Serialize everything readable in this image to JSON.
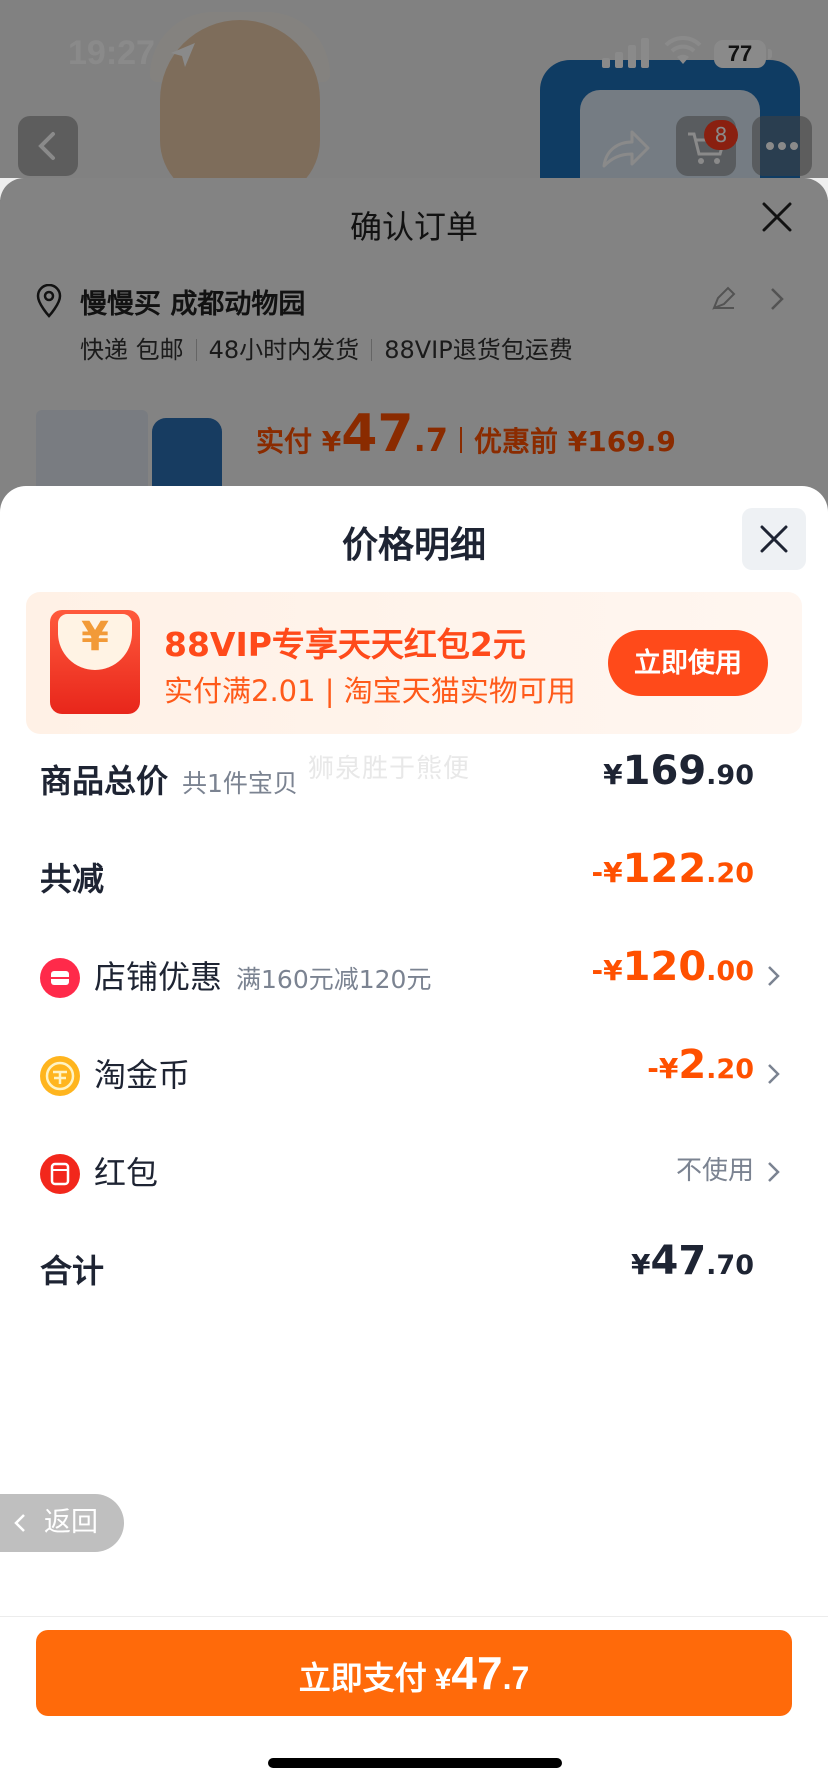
{
  "status_bar": {
    "time": "19:27",
    "battery": "77"
  },
  "nav": {
    "cart_count": "8"
  },
  "order_sheet": {
    "title": "确认订单",
    "address_name": "慢慢买 成都动物园",
    "shipping": [
      "快递 包邮",
      "48小时内发货",
      "88VIP退货包运费"
    ],
    "paid_label": "实付 ¥",
    "paid_int": "47",
    "paid_dec": ".7",
    "before_label": "优惠前 ¥169.9"
  },
  "price_detail": {
    "title": "价格明细",
    "promo": {
      "title": "88VIP专享天天红包2元",
      "subtitle": "实付满2.01 | 淘宝天猫实物可用",
      "button": "立即使用",
      "icon_char": "¥"
    },
    "watermark": "狮泉胜于熊便",
    "rows": {
      "total": {
        "label": "商品总价",
        "sub": "共1件宝贝",
        "yen": "¥",
        "int": "169",
        "dec": ".90"
      },
      "reduced": {
        "label": "共减",
        "yen": "-¥",
        "int": "122",
        "dec": ".20"
      },
      "store": {
        "label": "店铺优惠",
        "sub": "满160元减120元",
        "yen": "-¥",
        "int": "120",
        "dec": ".00",
        "icon": "store-icon"
      },
      "coin": {
        "label": "淘金币",
        "yen": "-¥",
        "int": "2",
        "dec": ".20",
        "icon": "coin-icon"
      },
      "redpack": {
        "label": "红包",
        "value": "不使用",
        "icon": "red-packet-icon"
      },
      "sum": {
        "label": "合计",
        "yen": "¥",
        "int": "47",
        "dec": ".70"
      }
    },
    "back_label": "返回",
    "pay": {
      "label": "立即支付",
      "yen": "¥",
      "int": "47",
      "dec": ".7"
    }
  },
  "colors": {
    "accent": "#ff5000",
    "pay_button": "#ff6a0a",
    "promo_bg": "#fff1e6",
    "text_dark": "#1e2433"
  }
}
